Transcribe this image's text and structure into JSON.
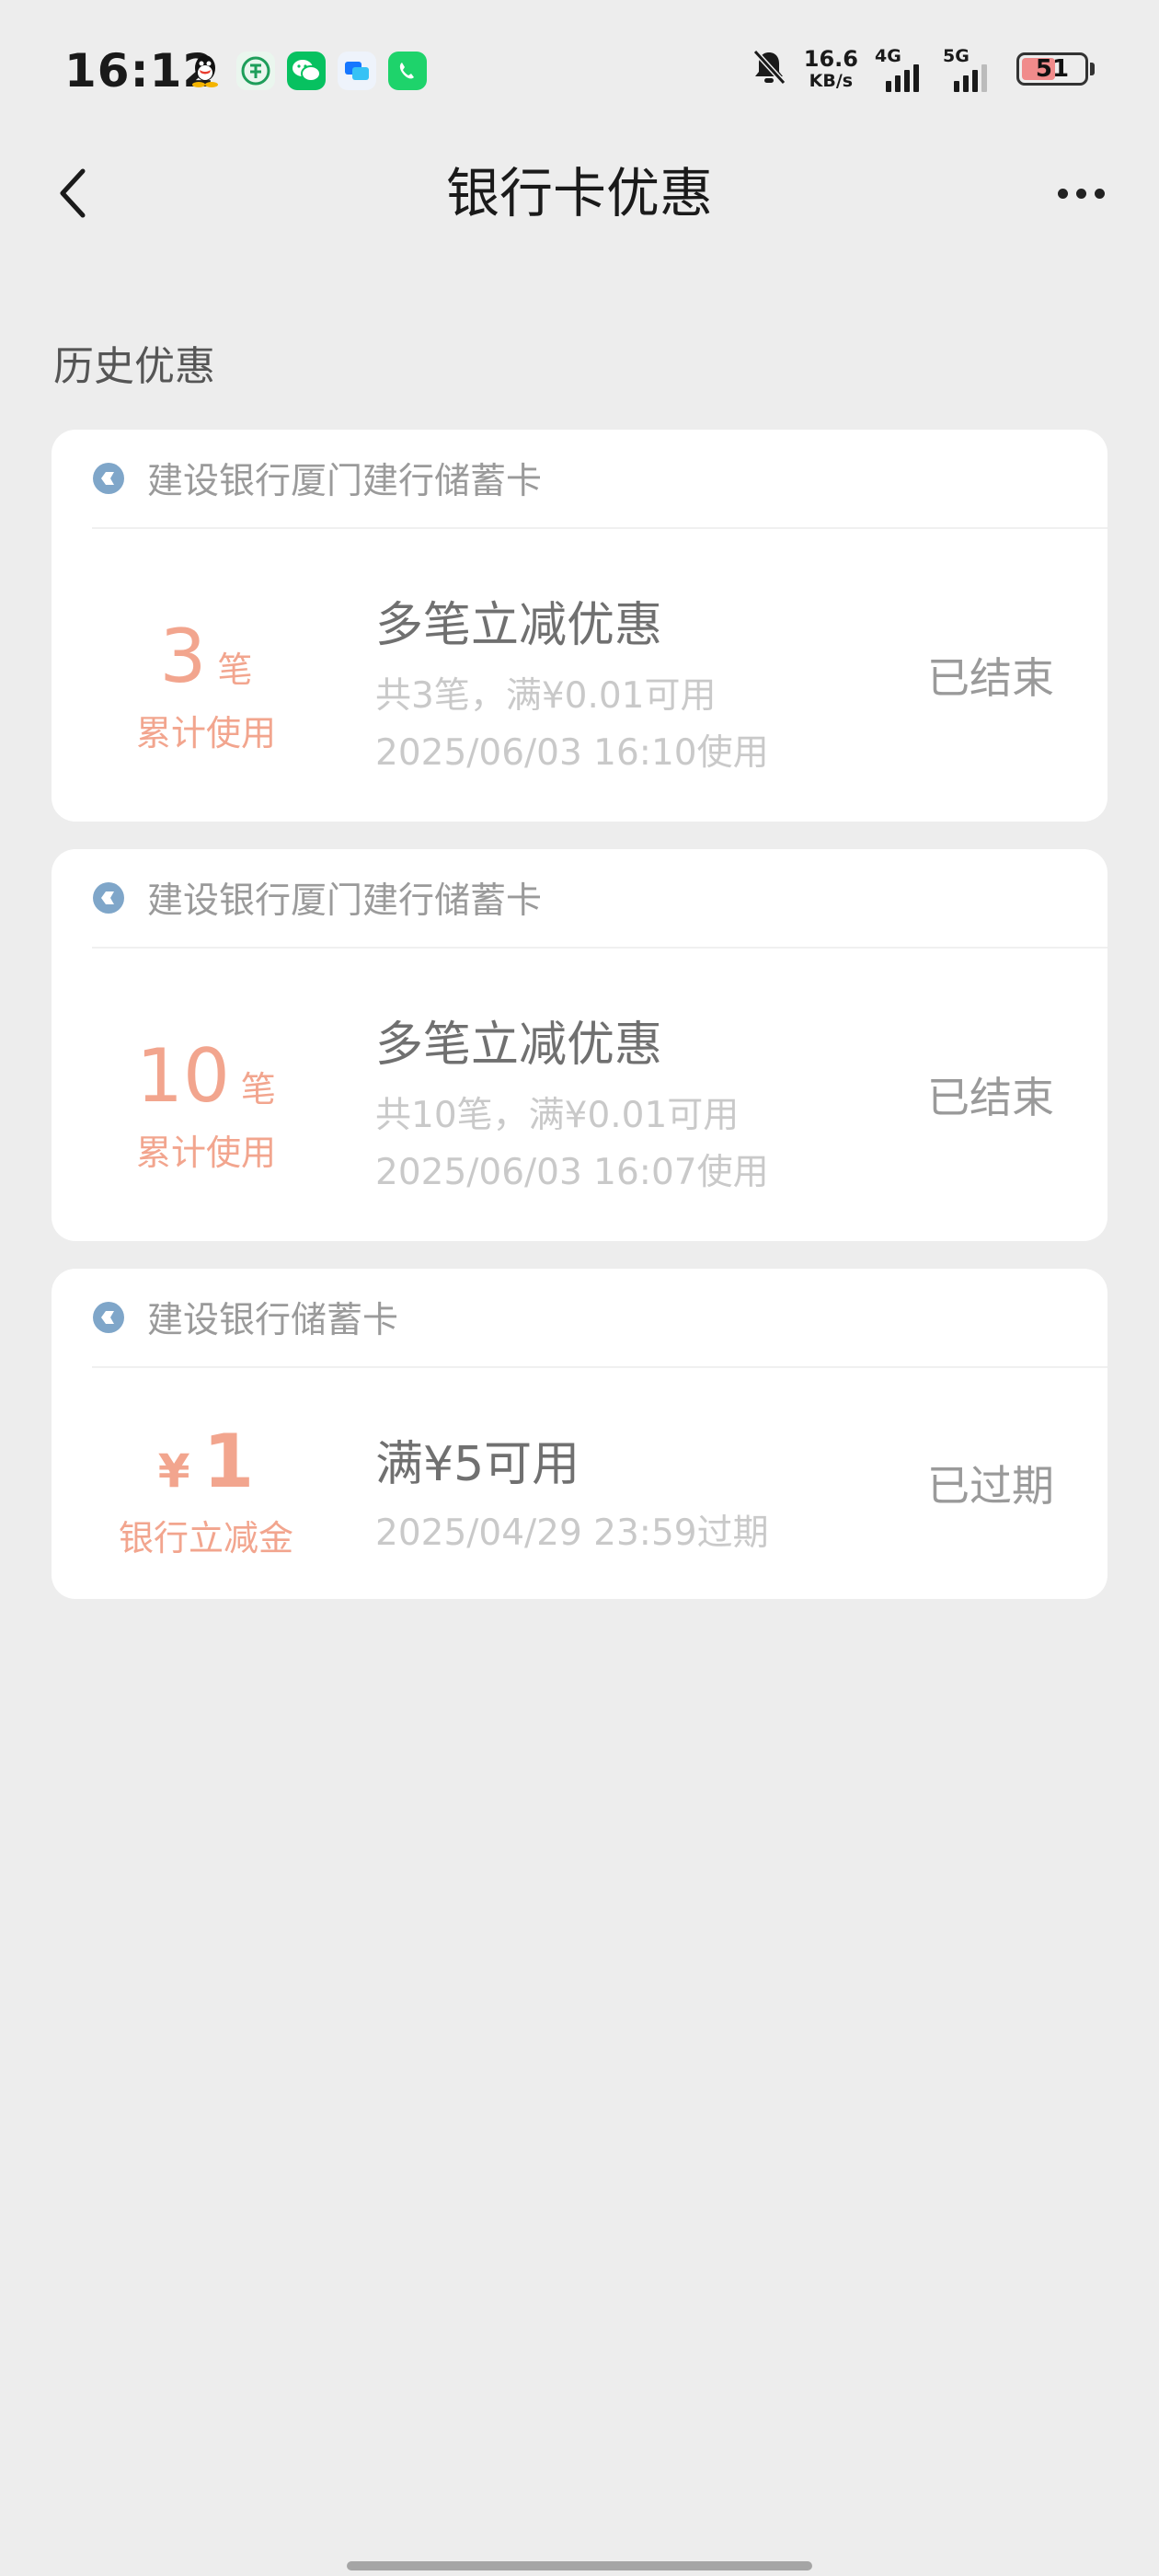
{
  "status_bar": {
    "time": "16:12",
    "net_speed_value": "16.6",
    "net_speed_unit": "KB/s",
    "signal1_label": "4G",
    "signal2_label": "5G",
    "battery": "51"
  },
  "nav": {
    "title": "银行卡优惠"
  },
  "section_title": "历史优惠",
  "coupons": [
    {
      "bank": "建设银行厦门建行储蓄卡",
      "amount": "3",
      "unit": "笔",
      "sub": "累计使用",
      "title": "多笔立减优惠",
      "desc1": "共3笔，满¥0.01可用",
      "desc2": "2025/06/03 16:10使用",
      "status": "已结束"
    },
    {
      "bank": "建设银行厦门建行储蓄卡",
      "amount": "10",
      "unit": "笔",
      "sub": "累计使用",
      "title": "多笔立减优惠",
      "desc1": "共10笔，满¥0.01可用",
      "desc2": "2025/06/03 16:07使用",
      "status": "已结束"
    },
    {
      "bank": "建设银行储蓄卡",
      "currency": "¥",
      "amount": "1",
      "sub": "银行立减金",
      "title": "满¥5可用",
      "desc1": "2025/04/29 23:59过期",
      "status": "已过期"
    }
  ],
  "colors": {
    "accent": "#f2a58e",
    "bank_logo": "#7fa6c9",
    "background": "#ededed"
  }
}
